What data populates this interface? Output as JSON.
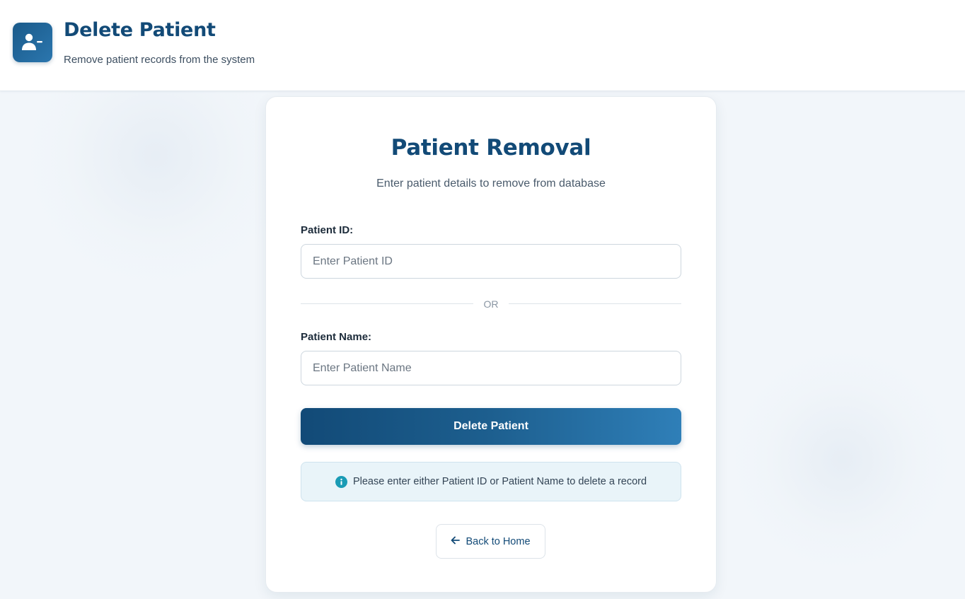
{
  "header": {
    "icon": "user-minus-icon",
    "title": "Delete Patient",
    "subtitle": "Remove patient records from the system"
  },
  "card": {
    "title": "Patient Removal",
    "subtitle": "Enter patient details to remove from database",
    "patient_id": {
      "label": "Patient ID:",
      "placeholder": "Enter Patient ID",
      "value": ""
    },
    "divider": "OR",
    "patient_name": {
      "label": "Patient Name:",
      "placeholder": "Enter Patient Name",
      "value": ""
    },
    "delete_button": "Delete Patient",
    "info": {
      "icon": "info-circle-icon",
      "text": "Please enter either Patient ID or Patient Name to delete a record"
    },
    "back_button": {
      "icon": "arrow-left-icon",
      "label": "Back to Home"
    }
  },
  "colors": {
    "primary": "#124a77",
    "accent": "#2f7fb8",
    "info_background": "#e9f4f9",
    "info_icon": "#1a9bb5",
    "page_background": "#f2f6fa"
  }
}
